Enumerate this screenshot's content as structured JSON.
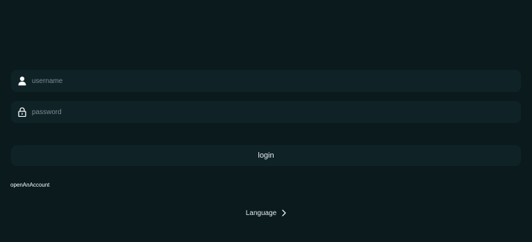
{
  "login_form": {
    "username": {
      "placeholder": "username",
      "value": "",
      "icon": "user-icon"
    },
    "password": {
      "placeholder": "password",
      "value": "",
      "icon": "lock-icon"
    },
    "login_label": "login"
  },
  "links": {
    "open_account_label": "openAnAccount",
    "language_label": "Language",
    "language_icon": "chevron-right-icon"
  },
  "colors": {
    "background": "#0a1a1d",
    "field_background": "#0f2327",
    "placeholder_text": "#7e8c8f",
    "text": "#ffffff"
  }
}
